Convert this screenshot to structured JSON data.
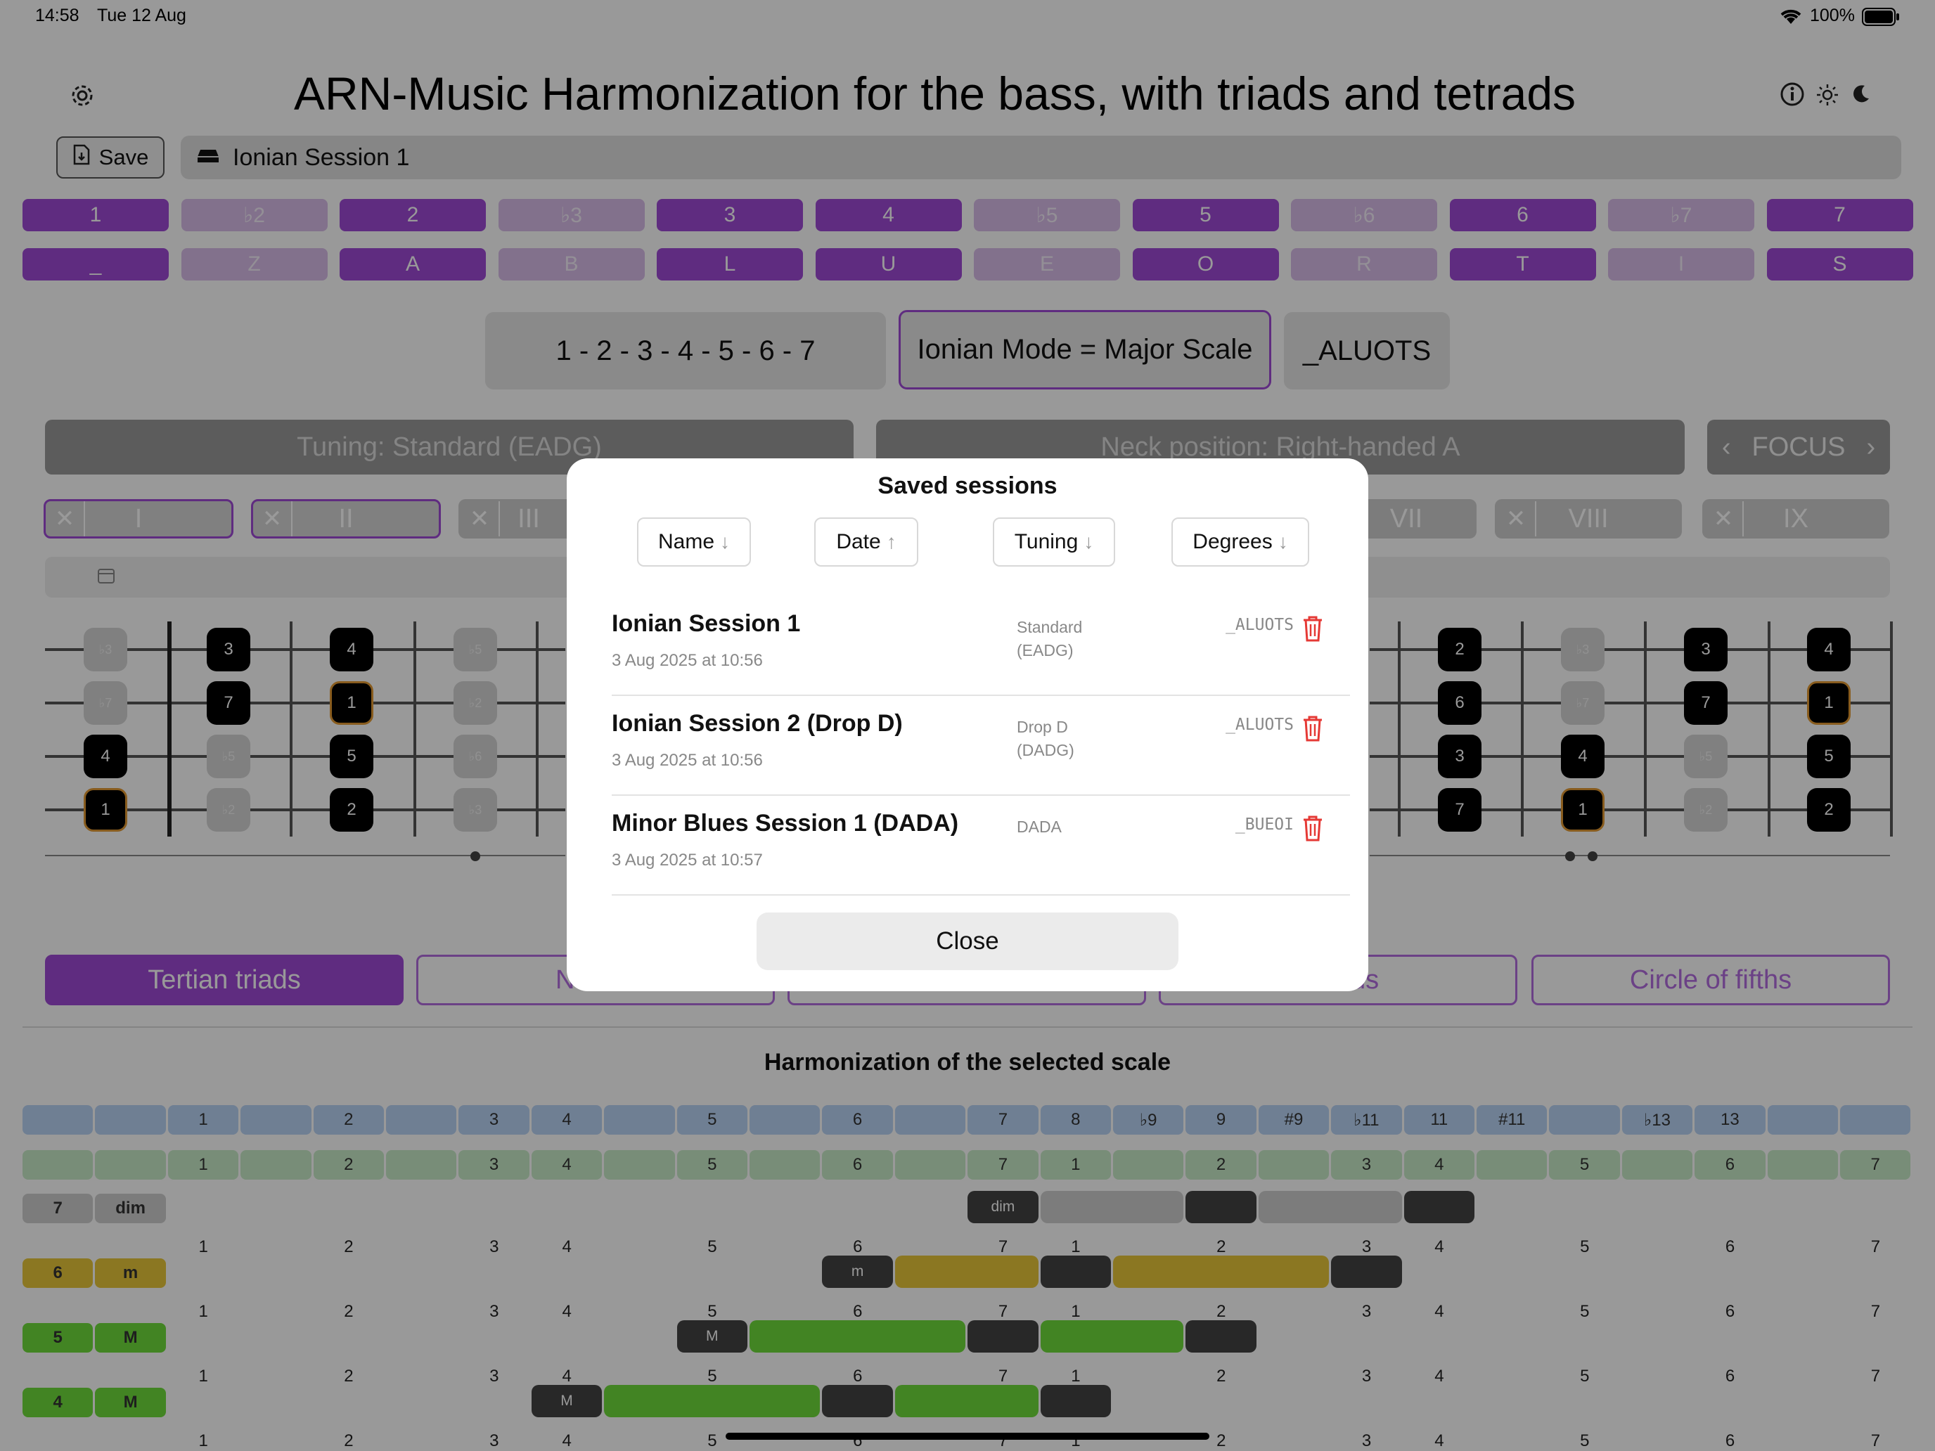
{
  "status_bar": {
    "time": "14:58",
    "date": "Tue 12 Aug",
    "battery": "100%"
  },
  "header": {
    "title": "ARN-Music   Harmonization for the bass, with triads and tetrads"
  },
  "toolbar": {
    "save_label": "Save",
    "session_name": "Ionian Session 1"
  },
  "degrees": [
    "1",
    "♭2",
    "2",
    "♭3",
    "3",
    "4",
    "♭5",
    "5",
    "♭6",
    "6",
    "♭7",
    "7"
  ],
  "letters": [
    "_",
    "Z",
    "A",
    "B",
    "L",
    "U",
    "E",
    "O",
    "R",
    "T",
    "I",
    "S"
  ],
  "active_degrees": [
    true,
    false,
    true,
    false,
    true,
    true,
    false,
    true,
    false,
    true,
    false,
    true
  ],
  "scale": {
    "formula": "1 - 2 - 3 - 4 - 5 - 6 - 7",
    "name": "Ionian Mode = Major Scale",
    "code": "_ALUOTS"
  },
  "controls": {
    "tuning": "Tuning: Standard (EADG)",
    "neck": "Neck position: Right-handed A",
    "focus": "FOCUS"
  },
  "positions": [
    "I",
    "II",
    "III",
    "VII",
    "VIII",
    "IX"
  ],
  "fretboard_left": [
    {
      "label": "♭3",
      "s": 0,
      "f": 0,
      "type": "ghost"
    },
    {
      "label": "3",
      "s": 0,
      "f": 1,
      "type": "note"
    },
    {
      "label": "4",
      "s": 0,
      "f": 2,
      "type": "note"
    },
    {
      "label": "♭5",
      "s": 0,
      "f": 3,
      "type": "ghost"
    },
    {
      "label": "♭7",
      "s": 1,
      "f": 0,
      "type": "ghost"
    },
    {
      "label": "7",
      "s": 1,
      "f": 1,
      "type": "note"
    },
    {
      "label": "1",
      "s": 1,
      "f": 2,
      "type": "root"
    },
    {
      "label": "♭2",
      "s": 1,
      "f": 3,
      "type": "ghost"
    },
    {
      "label": "4",
      "s": 2,
      "f": 0,
      "type": "note"
    },
    {
      "label": "♭5",
      "s": 2,
      "f": 1,
      "type": "ghost"
    },
    {
      "label": "5",
      "s": 2,
      "f": 2,
      "type": "note"
    },
    {
      "label": "♭6",
      "s": 2,
      "f": 3,
      "type": "ghost"
    },
    {
      "label": "1",
      "s": 3,
      "f": 0,
      "type": "root"
    },
    {
      "label": "♭2",
      "s": 3,
      "f": 1,
      "type": "ghost"
    },
    {
      "label": "2",
      "s": 3,
      "f": 2,
      "type": "note"
    },
    {
      "label": "♭3",
      "s": 3,
      "f": 3,
      "type": "ghost"
    }
  ],
  "fretboard_right": [
    {
      "label": "2",
      "s": 0,
      "f": 0,
      "type": "note"
    },
    {
      "label": "♭3",
      "s": 0,
      "f": 1,
      "type": "ghost"
    },
    {
      "label": "3",
      "s": 0,
      "f": 2,
      "type": "note"
    },
    {
      "label": "4",
      "s": 0,
      "f": 3,
      "type": "note"
    },
    {
      "label": "6",
      "s": 1,
      "f": 0,
      "type": "note"
    },
    {
      "label": "♭7",
      "s": 1,
      "f": 1,
      "type": "ghost"
    },
    {
      "label": "7",
      "s": 1,
      "f": 2,
      "type": "note"
    },
    {
      "label": "1",
      "s": 1,
      "f": 3,
      "type": "root"
    },
    {
      "label": "3",
      "s": 2,
      "f": 0,
      "type": "note"
    },
    {
      "label": "4",
      "s": 2,
      "f": 1,
      "type": "note"
    },
    {
      "label": "♭5",
      "s": 2,
      "f": 2,
      "type": "ghost"
    },
    {
      "label": "5",
      "s": 2,
      "f": 3,
      "type": "note"
    },
    {
      "label": "7",
      "s": 3,
      "f": 0,
      "type": "note"
    },
    {
      "label": "1",
      "s": 3,
      "f": 1,
      "type": "root"
    },
    {
      "label": "♭2",
      "s": 3,
      "f": 2,
      "type": "ghost"
    },
    {
      "label": "2",
      "s": 3,
      "f": 3,
      "type": "note"
    }
  ],
  "tabs": [
    "Tertian triads",
    "Non-te",
    "",
    "tetrads",
    "Circle of fifths"
  ],
  "harmonization": {
    "title": "Harmonization of the selected scale",
    "ext_row": [
      "",
      "",
      "1",
      "",
      "2",
      "",
      "3",
      "4",
      "",
      "5",
      "",
      "6",
      "",
      "7",
      "8",
      "♭9",
      "9",
      "#9",
      "♭11",
      "11",
      "#11",
      "",
      "♭13",
      "13",
      "",
      ""
    ],
    "deg_row": [
      "",
      "",
      "1",
      "",
      "2",
      "",
      "3",
      "4",
      "",
      "5",
      "",
      "6",
      "",
      "7",
      "1",
      "",
      "2",
      "",
      "3",
      "4",
      "",
      "5",
      "",
      "6",
      "",
      "7"
    ],
    "num_row": [
      "",
      "",
      "1",
      "",
      "2",
      "",
      "3",
      "4",
      "",
      "5",
      "",
      "6",
      "",
      "7",
      "1",
      "",
      "2",
      "",
      "3",
      "4",
      "",
      "5",
      "",
      "6",
      "",
      "7"
    ],
    "chords": [
      {
        "degree": "7",
        "quality": "dim",
        "label": "dim",
        "color": "#cfcfcf",
        "bar": "#444444"
      },
      {
        "degree": "6",
        "quality": "m",
        "label": "m",
        "color": "#e8c73a",
        "bar": "#444444"
      },
      {
        "degree": "5",
        "quality": "M",
        "label": "M",
        "color": "#6fdc3b",
        "bar": "#444444"
      },
      {
        "degree": "4",
        "quality": "M",
        "label": "M",
        "color": "#6fdc3b",
        "bar": "#444444"
      }
    ]
  },
  "modal": {
    "title": "Saved sessions",
    "sort": [
      {
        "label": "Name",
        "arrow": "↓"
      },
      {
        "label": "Date",
        "arrow": "↑"
      },
      {
        "label": "Tuning",
        "arrow": "↓"
      },
      {
        "label": "Degrees",
        "arrow": "↓"
      }
    ],
    "sessions": [
      {
        "name": "Ionian Session 1",
        "date": "3 Aug 2025 at 10:56",
        "tuning_a": "Standard",
        "tuning_b": "(EADG)",
        "degrees": "_ALUOTS"
      },
      {
        "name": "Ionian Session 2 (Drop D)",
        "date": "3 Aug 2025 at 10:56",
        "tuning_a": "Drop D",
        "tuning_b": "(DADG)",
        "degrees": "_ALUOTS"
      },
      {
        "name": "Minor Blues Session 1 (DADA)",
        "date": "3 Aug 2025 at 10:57",
        "tuning_a": "DADA",
        "tuning_b": "",
        "degrees": "_BUEOI"
      }
    ],
    "close_label": "Close"
  },
  "colors": {
    "accent": "#9f4ad6",
    "delete": "#e53935",
    "root_border": "#e39a33"
  }
}
